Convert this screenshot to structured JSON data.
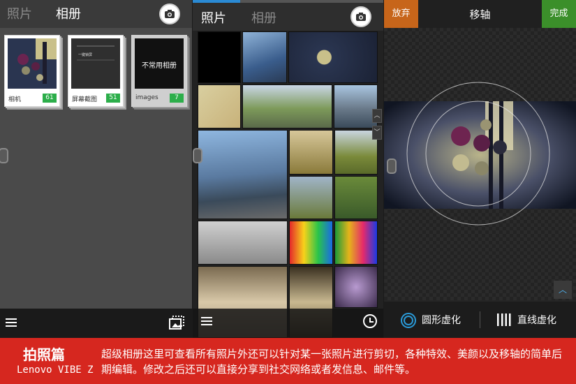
{
  "panel1": {
    "tabs": [
      {
        "label": "照片",
        "active": false
      },
      {
        "label": "相册",
        "active": true
      }
    ],
    "albums": [
      {
        "name": "相机",
        "count": "61"
      },
      {
        "name": "屏幕截图",
        "count": "51",
        "thumb_text": "一键锁屏"
      },
      {
        "name": "images",
        "count": "7",
        "thumb_text": "不常用相册"
      }
    ],
    "icons": {
      "camera": "camera-icon",
      "menu": "hamburger-menu-icon",
      "slideshow": "slideshow-icon"
    }
  },
  "panel2": {
    "tabs": [
      {
        "label": "照片",
        "active": true
      },
      {
        "label": "相册",
        "active": false
      }
    ],
    "progress": 0.25,
    "icons": {
      "camera": "camera-icon",
      "menu": "hamburger-menu-icon",
      "timeline": "clock-icon",
      "scroll_up": "chevron-up-icon",
      "scroll_down": "chevron-down-icon"
    }
  },
  "panel3": {
    "cancel_label": "放弃",
    "title": "移轴",
    "done_label": "完成",
    "tools": [
      {
        "label": "圆形虚化",
        "icon": "circle-blur-icon"
      },
      {
        "label": "直线虚化",
        "icon": "linear-blur-icon"
      }
    ],
    "colors": {
      "cancel": "#c7651a",
      "done": "#3b8f2a",
      "accent": "#2a8ad4"
    }
  },
  "banner": {
    "title": "拍照篇",
    "subtitle": "Lenovo VIBE Z",
    "description": "超级相册这里可查看所有照片外还可以针对某一张照片进行剪切，各种特效、美颜以及移轴的简单后期编辑。修改之后还可以直接分享到社交网络或者发信息、邮件等。",
    "color": "#d6271f"
  }
}
